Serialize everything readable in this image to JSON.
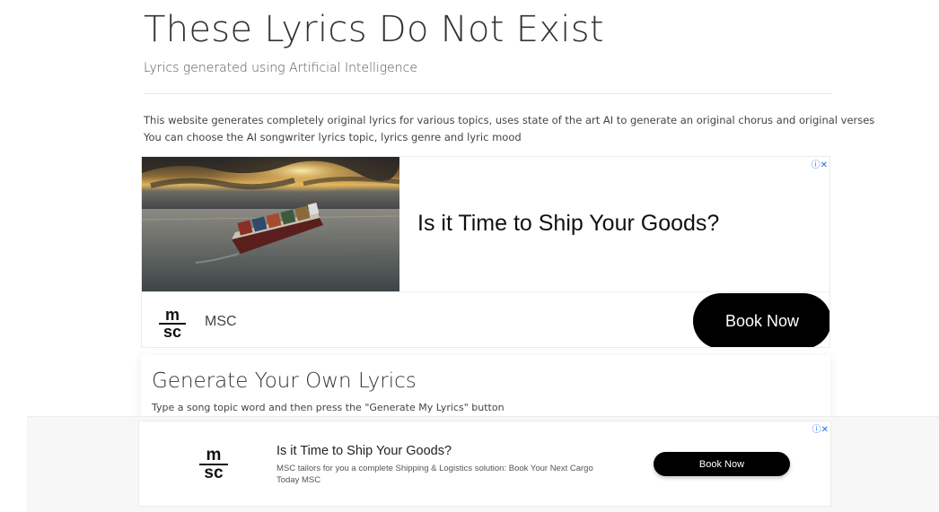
{
  "header": {
    "title": "These Lyrics Do Not Exist",
    "subtitle": "Lyrics generated using Artificial Intelligence"
  },
  "intro": {
    "line1": "This website generates completely original lyrics for various topics, uses state of the art AI to generate an original chorus and original verses",
    "line2": "You can choose the AI songwriter lyrics topic, lyrics genre and lyric mood"
  },
  "ad_top": {
    "headline": "Is it Time to Ship Your Goods?",
    "advertiser": "MSC",
    "cta_label": "Book Now",
    "adchoices": "ⓘ✕",
    "logo_top": "m",
    "logo_bottom": "sc"
  },
  "generate": {
    "title": "Generate Your Own Lyrics",
    "help": "Type a song topic word and then press the \"Generate My Lyrics\" button"
  },
  "ad_bottom": {
    "headline": "Is it Time to Ship Your Goods?",
    "body": "MSC tailors for you a complete Shipping & Logistics solution: Book Your Next Cargo Today MSC",
    "cta_label": "Book Now",
    "adchoices": "ⓘ✕",
    "logo_top": "m",
    "logo_bottom": "sc"
  },
  "colors": {
    "cta_bg": "#000000",
    "adchoices": "#1a73e8"
  }
}
